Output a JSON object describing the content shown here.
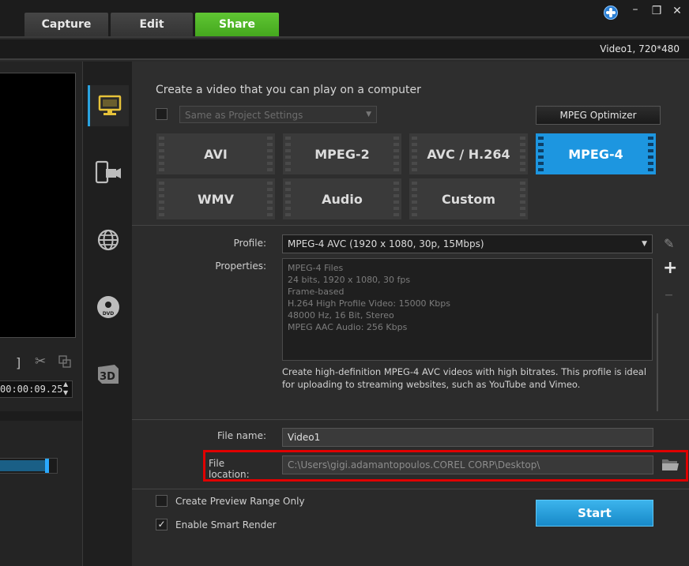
{
  "tabs": [
    {
      "label": "Capture",
      "active": false
    },
    {
      "label": "Edit",
      "active": false
    },
    {
      "label": "Share",
      "active": true
    }
  ],
  "window_controls": {
    "minimize": "–",
    "maximize": "❒",
    "close": "✕"
  },
  "project_info": "Video1, 720*480",
  "left_panel": {
    "timecode": "00:00:09.25",
    "progress": 0.85
  },
  "side_icons": [
    "computer-icon",
    "device-icon",
    "web-icon",
    "dvd-icon",
    "3d-icon"
  ],
  "main": {
    "heading": "Create a video that you can play on a computer",
    "same_settings_label": "Same as Project Settings",
    "same_settings_checked": false,
    "mpeg_optimizer": "MPEG Optimizer",
    "formats": [
      {
        "label": "AVI",
        "selected": false
      },
      {
        "label": "MPEG-2",
        "selected": false
      },
      {
        "label": "AVC / H.264",
        "selected": false
      },
      {
        "label": "MPEG-4",
        "selected": true
      },
      {
        "label": "WMV",
        "selected": false
      },
      {
        "label": "Audio",
        "selected": false
      },
      {
        "label": "Custom",
        "selected": false
      }
    ],
    "profile_label": "Profile:",
    "profile_value": "MPEG-4 AVC (1920 x 1080, 30p, 15Mbps)",
    "properties_label": "Properties:",
    "properties": [
      "MPEG-4 Files",
      "24 bits, 1920 x 1080, 30 fps",
      "Frame-based",
      "H.264 High Profile Video: 15000 Kbps",
      "48000 Hz, 16 Bit, Stereo",
      "MPEG AAC Audio: 256 Kbps"
    ],
    "profile_description": "Create high-definition MPEG-4 AVC videos with high bitrates. This profile is ideal for uploading to streaming websites, such as YouTube and Vimeo.",
    "file_name_label": "File name:",
    "file_name_value": "Video1",
    "file_location_label": "File location:",
    "file_location_value": "C:\\Users\\gigi.adamantopoulos.COREL CORP\\Desktop\\",
    "preview_range_label": "Create Preview Range Only",
    "preview_range_checked": false,
    "smart_render_label": "Enable Smart Render",
    "smart_render_checked": true,
    "start_label": "Start"
  },
  "colors": {
    "accent_green": "#4fb625",
    "accent_blue": "#1d96e0",
    "highlight_red": "#e00000"
  }
}
